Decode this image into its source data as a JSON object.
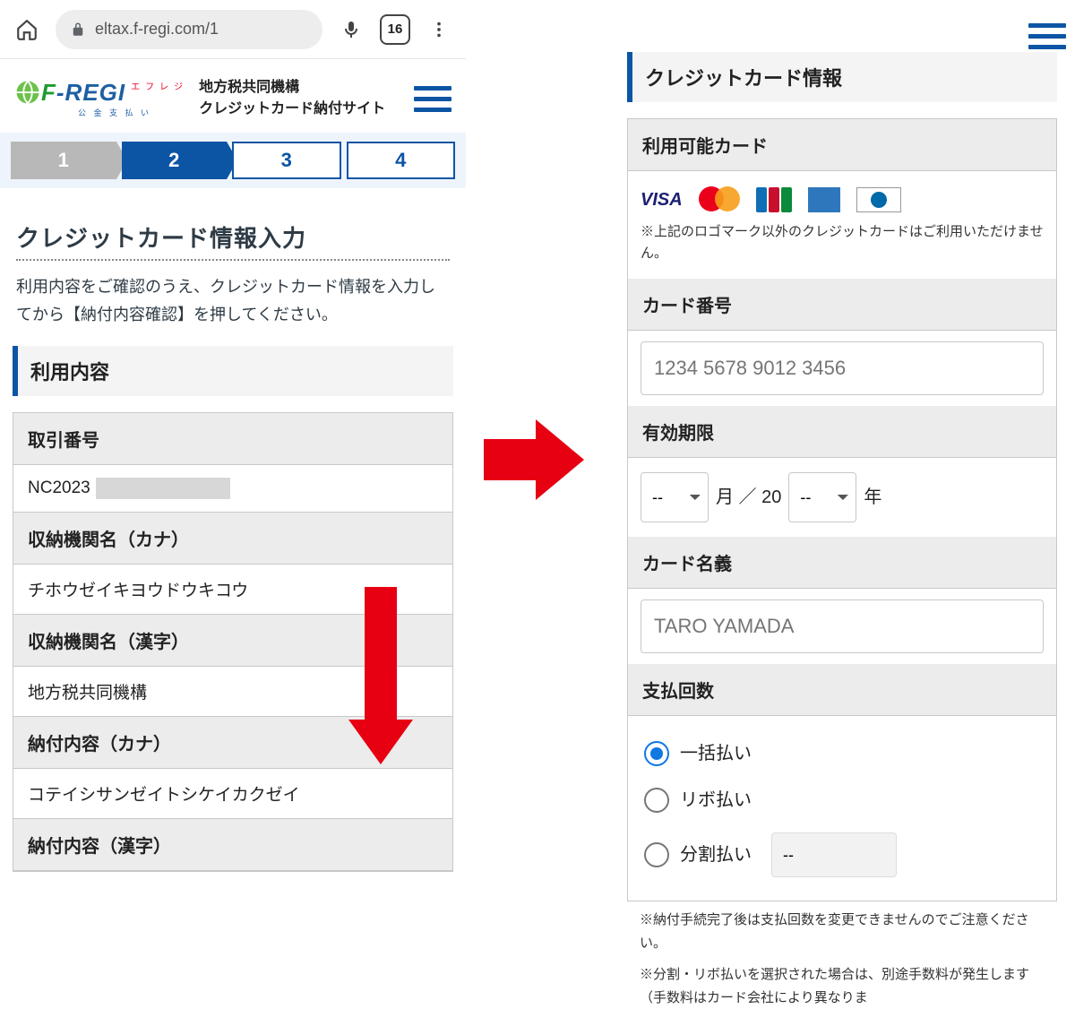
{
  "browser": {
    "url": "eltax.f-regi.com/1",
    "tab_count": "16"
  },
  "site": {
    "logo_f": "F",
    "logo_rest": "-REGI",
    "logo_tag": "エフレジ",
    "logo_sub": "公 金 支 払 い",
    "title_line1": "地方税共同機構",
    "title_line2": "クレジットカード納付サイト"
  },
  "steps": {
    "s1": "1",
    "s2": "2",
    "s3": "3",
    "s4": "4"
  },
  "page": {
    "heading": "クレジットカード情報入力",
    "lead": "利用内容をご確認のうえ、クレジットカード情報を入力してから【納付内容確認】を押してください。"
  },
  "usage": {
    "section": "利用内容",
    "rows": {
      "txn_no_h": "取引番号",
      "txn_no_v": "NC2023",
      "org_kana_h": "収納機関名（カナ）",
      "org_kana_v": "チホウゼイキヨウドウキコウ",
      "org_kanji_h": "収納機関名（漢字）",
      "org_kanji_v": "地方税共同機構",
      "content_kana_h": "納付内容（カナ）",
      "content_kana_v": "コテイシサンゼイトシケイカクゼイ",
      "content_kanji_h": "納付内容（漢字）"
    }
  },
  "cc": {
    "section": "クレジットカード情報",
    "avail_h": "利用可能カード",
    "avail_note": "上記のロゴマーク以外のクレジットカードはご利用いただけません。",
    "number_h": "カード番号",
    "number_ph": "1234 5678 9012 3456",
    "expiry_h": "有効期限",
    "exp_month": "--",
    "exp_month_suffix": "月 ／ 20",
    "exp_year": "--",
    "exp_year_suffix": "年",
    "name_h": "カード名義",
    "name_ph": "TARO YAMADA",
    "paytimes_h": "支払回数",
    "pay_once": "一括払い",
    "pay_revo": "リボ払い",
    "pay_split": "分割払い",
    "split_sel": "--",
    "note1": "納付手続完了後は支払回数を変更できませんのでご注意ください。",
    "note2": "分割・リボ払いを選択された場合は、別途手数料が発生します（手数料はカード会社により異なりま"
  }
}
